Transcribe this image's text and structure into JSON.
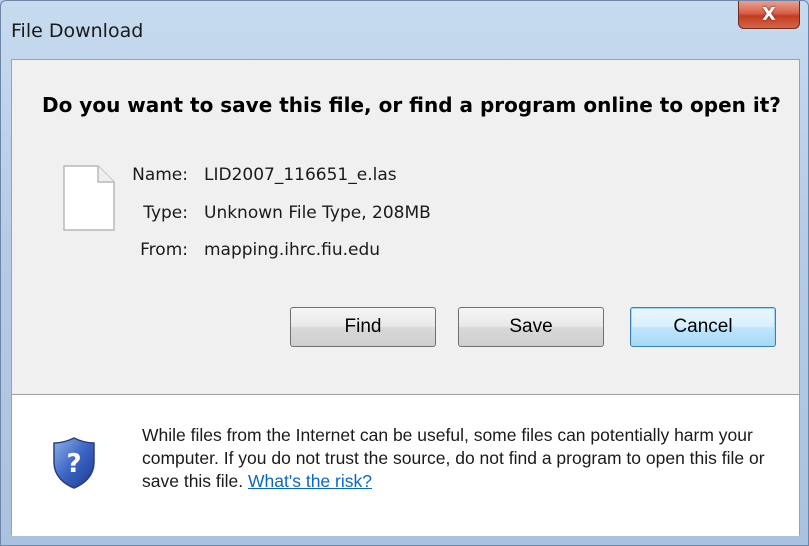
{
  "window": {
    "title": "File Download",
    "close_label": "X"
  },
  "dialog": {
    "question": "Do you want to save this file, or find a program online to open it?",
    "file": {
      "name_label": "Name:",
      "name_value": "LID2007_116651_e.las",
      "type_label": "Type:",
      "type_value": "Unknown File Type, 208MB",
      "from_label": "From:",
      "from_value": "mapping.ihrc.fiu.edu"
    },
    "buttons": {
      "find": "Find",
      "save": "Save",
      "cancel": "Cancel"
    },
    "warning": {
      "text": "While files from the Internet can be useful, some files can potentially harm your computer. If you do not trust the source, do not find a program to open this file or save this file. ",
      "link": "What's the risk?"
    }
  },
  "icons": {
    "file": "blank-file-icon",
    "shield": "security-shield-question-icon",
    "close": "close-icon"
  },
  "colors": {
    "link": "#0b66c4",
    "close_button": "#c23d22",
    "default_button_border": "#3c7fb1"
  }
}
